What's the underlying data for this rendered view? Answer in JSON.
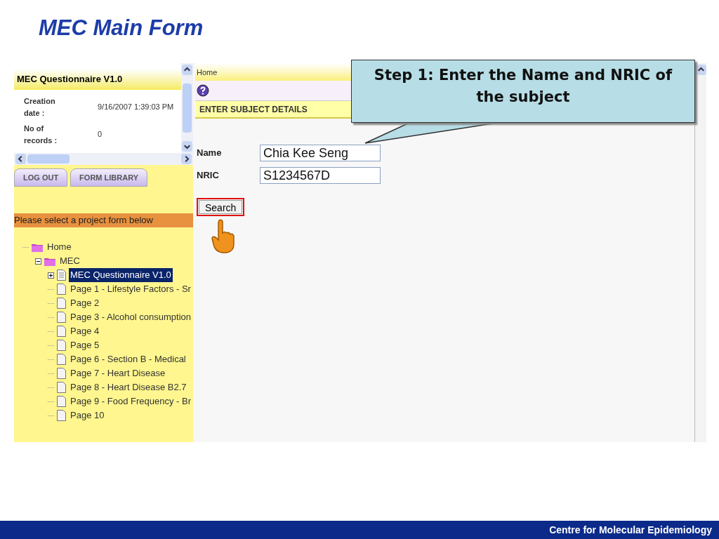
{
  "slide_title": "MEC Main Form",
  "info_panel": {
    "title": "MEC Questionnaire V1.0",
    "fields": [
      {
        "label": "Creation date :",
        "value": "9/16/2007 1:39:03 PM"
      },
      {
        "label": "No of records :",
        "value": "0"
      }
    ]
  },
  "nav_buttons": [
    "LOG OUT",
    "FORM LIBRARY"
  ],
  "project_prompt": "Please select a project form below",
  "tree": [
    {
      "label": "Home",
      "kind": "folder",
      "selected": false,
      "children": [
        {
          "label": "MEC",
          "kind": "folder",
          "expanded": true,
          "selected": false,
          "children": [
            {
              "label": "MEC Questionnaire V1.0",
              "kind": "form",
              "expanded": false,
              "selected": true
            },
            {
              "label": "Page 1 - Lifestyle Factors - Sr",
              "kind": "page",
              "selected": false
            },
            {
              "label": "Page 2",
              "kind": "page",
              "selected": false
            },
            {
              "label": "Page 3 - Alcohol consumption",
              "kind": "page",
              "selected": false
            },
            {
              "label": "Page 4",
              "kind": "page",
              "selected": false
            },
            {
              "label": "Page 5",
              "kind": "page",
              "selected": false
            },
            {
              "label": "Page 6 - Section B - Medical",
              "kind": "page",
              "selected": false
            },
            {
              "label": "Page 7 - Heart Disease",
              "kind": "page",
              "selected": false
            },
            {
              "label": "Page 8 - Heart Disease B2.7",
              "kind": "page",
              "selected": false
            },
            {
              "label": "Page 9 - Food Frequency - Br",
              "kind": "page",
              "selected": false
            },
            {
              "label": "Page 10",
              "kind": "page",
              "selected": false
            }
          ]
        }
      ]
    }
  ],
  "breadcrumb": "Home",
  "section_title": "ENTER SUBJECT DETAILS",
  "form_fields": [
    {
      "label": "Name",
      "value": "Chia Kee Seng"
    },
    {
      "label": "NRIC",
      "value": "S1234567D"
    }
  ],
  "search_button": "Search",
  "callout": "Step 1: Enter the Name and NRIC of the subject",
  "footer": "Centre for Molecular Epidemiology"
}
